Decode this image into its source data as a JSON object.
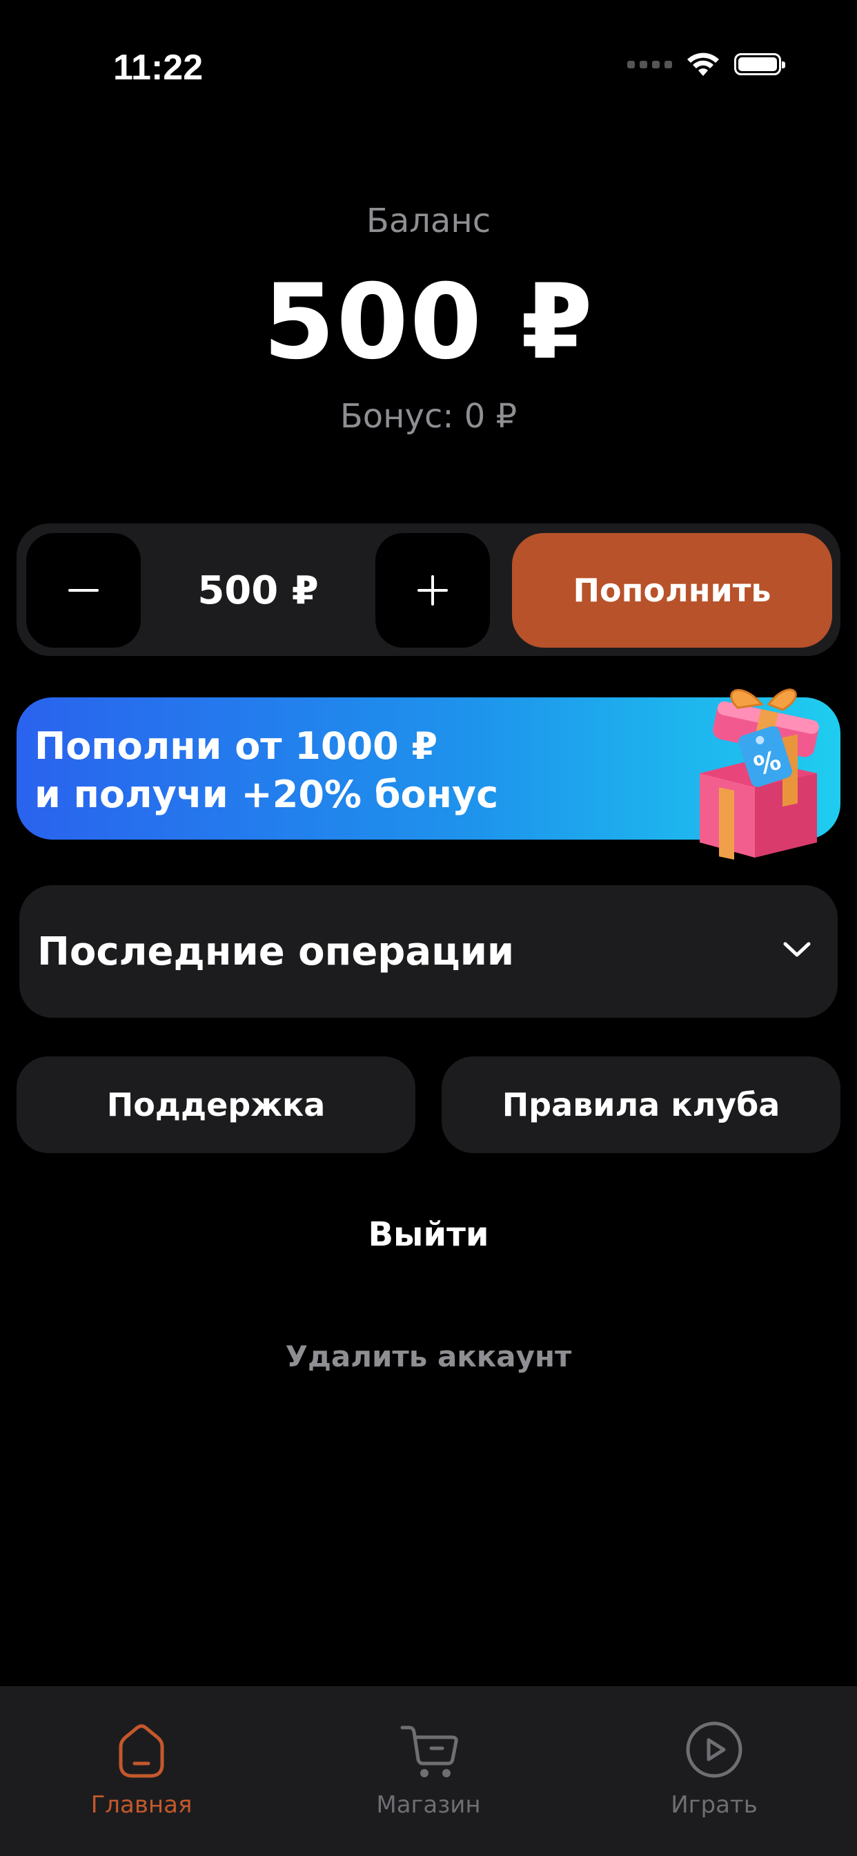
{
  "status_bar": {
    "time": "11:22",
    "wifi_icon": "wifi-icon",
    "battery_icon": "battery-icon"
  },
  "balance": {
    "label": "Баланс",
    "amount": "500 ₽",
    "bonus": "Бонус: 0 ₽"
  },
  "topup_control": {
    "minus": "−",
    "amount": "500 ₽",
    "plus": "+",
    "button": "Пополнить"
  },
  "promo": {
    "line1": "Пополни от 1000 ₽",
    "line2": "и получи +20% бонус"
  },
  "recent_operations": {
    "title": "Последние операции"
  },
  "buttons": {
    "support": "Поддержка",
    "rules": "Правила клуба",
    "logout": "Выйти",
    "delete_account": "Удалить аккаунт"
  },
  "tabbar": {
    "items": [
      {
        "label": "Главная",
        "icon": "home-icon",
        "active": true
      },
      {
        "label": "Магазин",
        "icon": "cart-icon",
        "active": false
      },
      {
        "label": "Играть",
        "icon": "play-icon",
        "active": false
      }
    ]
  },
  "colors": {
    "background": "#000000",
    "card": "#1c1c1e",
    "accent": "#b8522a",
    "active_tab": "#c4582c",
    "muted": "#8e8e93"
  }
}
